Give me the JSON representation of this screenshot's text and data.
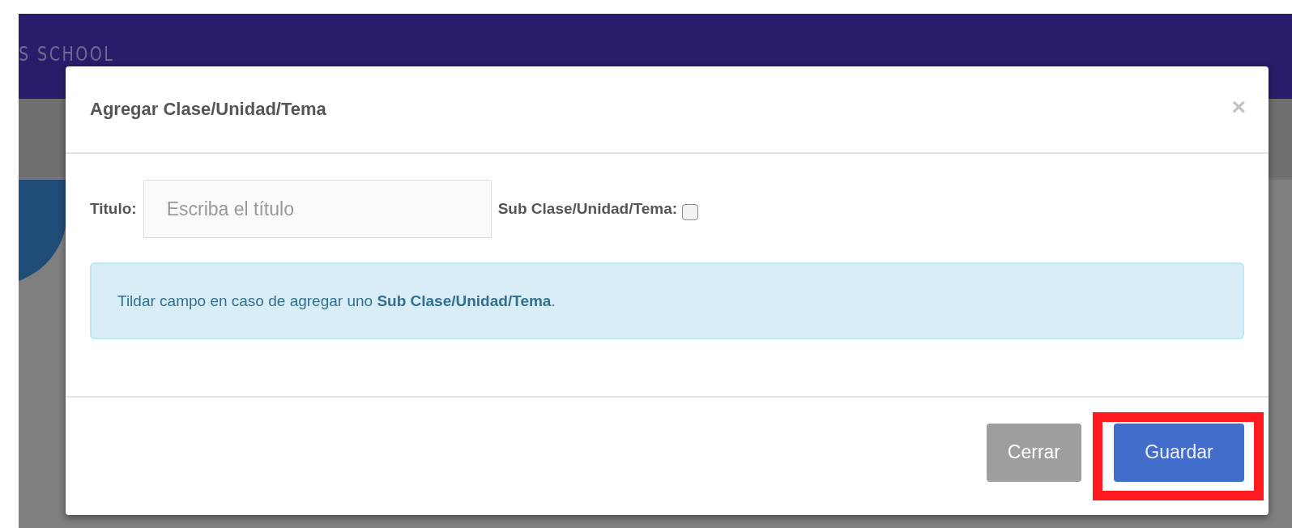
{
  "header": {
    "brand": "S SCHOOL"
  },
  "modal": {
    "title": "Agregar Clase/Unidad/Tema",
    "close": "×",
    "field": {
      "label": "Titulo:",
      "placeholder": "Escriba el título"
    },
    "sub_option": {
      "label": "Sub Clase/Unidad/Tema:",
      "checked": false
    },
    "alert": "Tildar campo en caso de agregar uno **Sub Clase/Unidad/Tema**.",
    "buttons": [
      {
        "label": "Cerrar",
        "kind": "secondary",
        "highlighted": false
      },
      {
        "label": "Guardar",
        "kind": "primary",
        "highlighted": true
      }
    ]
  }
}
